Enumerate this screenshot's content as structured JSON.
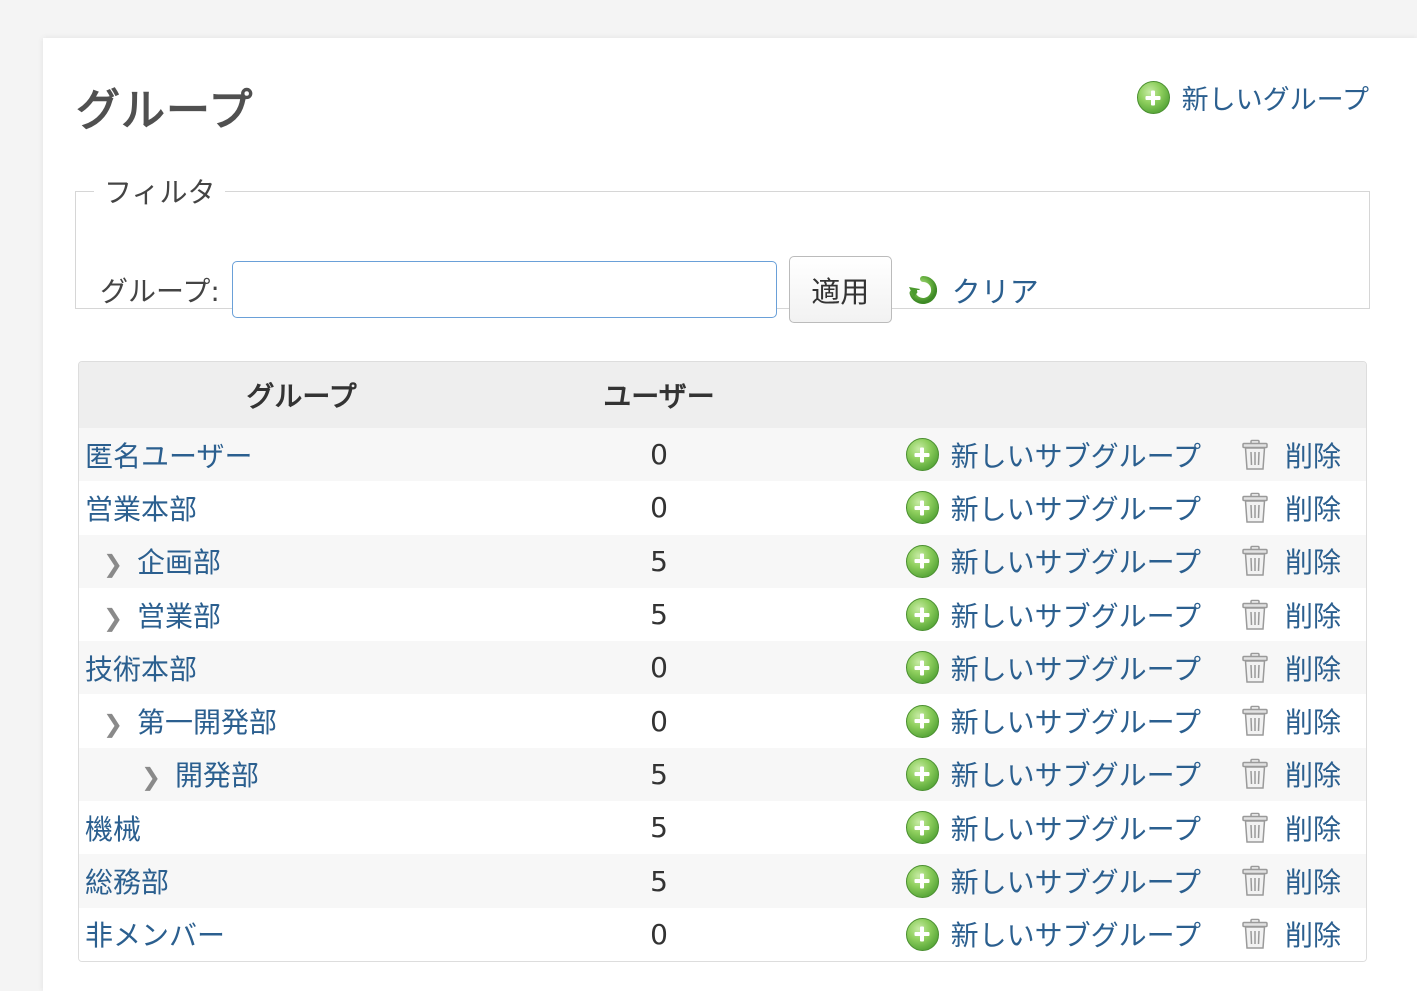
{
  "header": {
    "title": "グループ",
    "new_group_label": "新しいグループ"
  },
  "filter": {
    "legend": "フィルタ",
    "group_label": "グループ:",
    "group_value": "",
    "apply_label": "適用",
    "clear_label": "クリア"
  },
  "table": {
    "columns": [
      "グループ",
      "ユーザー",
      ""
    ],
    "add_subgroup_label": "新しいサブグループ",
    "delete_label": "削除",
    "rows": [
      {
        "name": "匿名ユーザー",
        "level": 0,
        "users": "0"
      },
      {
        "name": "営業本部",
        "level": 0,
        "users": "0"
      },
      {
        "name": "企画部",
        "level": 1,
        "users": "5"
      },
      {
        "name": "営業部",
        "level": 1,
        "users": "5"
      },
      {
        "name": "技術本部",
        "level": 0,
        "users": "0"
      },
      {
        "name": "第一開発部",
        "level": 1,
        "users": "0"
      },
      {
        "name": "開発部",
        "level": 2,
        "users": "5"
      },
      {
        "name": "機械",
        "level": 0,
        "users": "5"
      },
      {
        "name": "総務部",
        "level": 0,
        "users": "5"
      },
      {
        "name": "非メンバー",
        "level": 0,
        "users": "0"
      }
    ]
  },
  "colors": {
    "link": "#2b5f8f",
    "accent_green": "#5aa83a"
  },
  "icons": {
    "add": "plus-circle-icon",
    "clear": "reload-icon",
    "delete": "trash-icon",
    "expand": "chevron-right-icon"
  }
}
